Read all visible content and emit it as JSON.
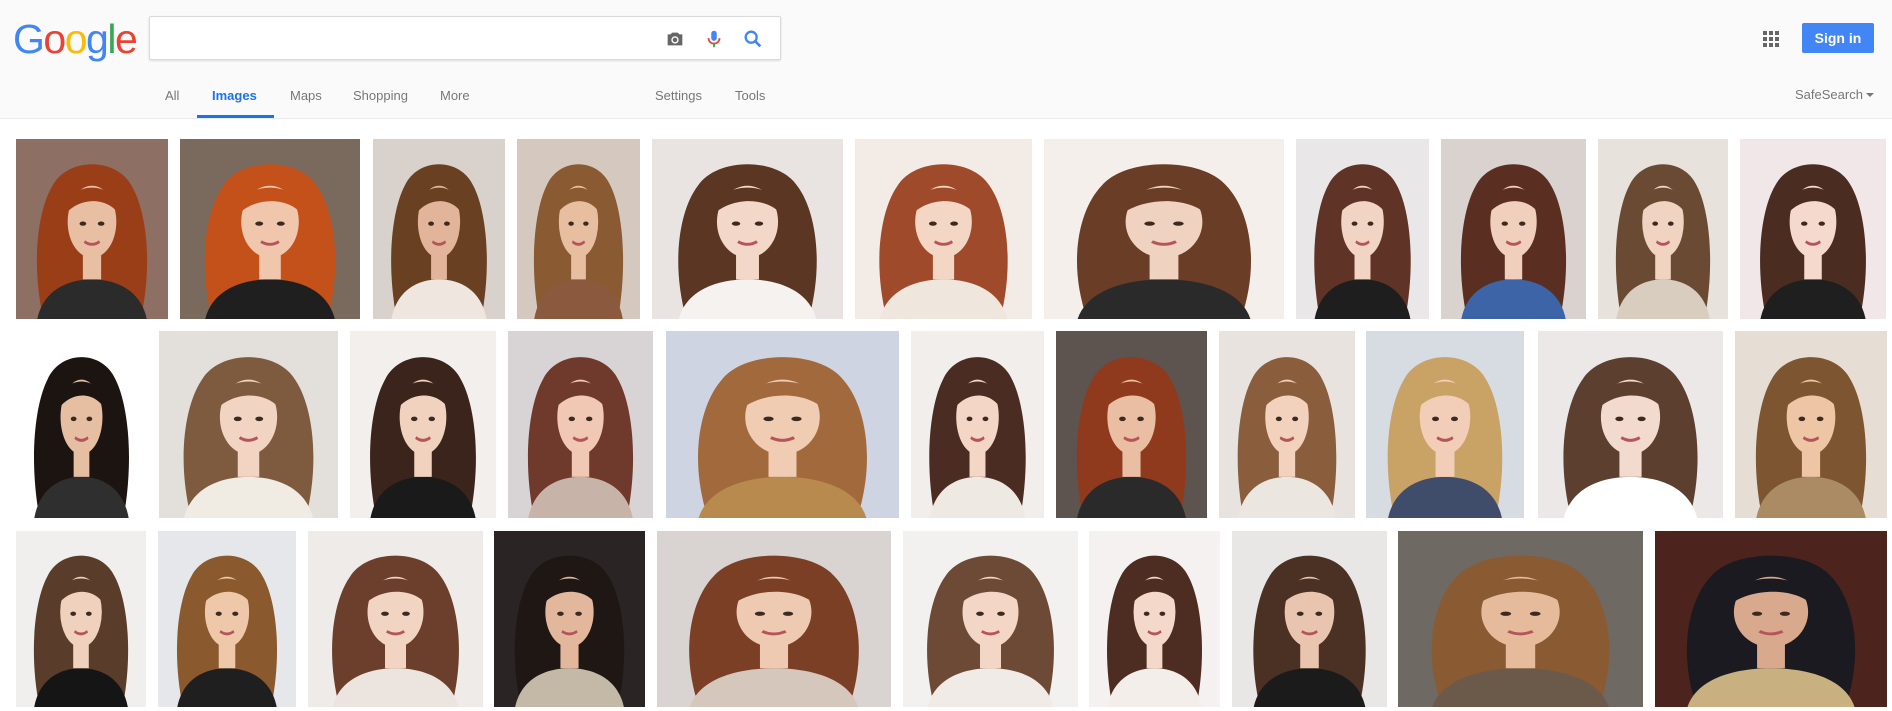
{
  "header": {
    "logo_letters": [
      {
        "ch": "G",
        "color": "#4285f4"
      },
      {
        "ch": "o",
        "color": "#ea4335"
      },
      {
        "ch": "o",
        "color": "#fbbc05"
      },
      {
        "ch": "g",
        "color": "#4285f4"
      },
      {
        "ch": "l",
        "color": "#34a853"
      },
      {
        "ch": "e",
        "color": "#ea4335"
      }
    ],
    "search_value": "",
    "icons": [
      "camera-icon",
      "microphone-icon",
      "search-icon",
      "apps-grid-icon"
    ],
    "sign_in_label": "Sign in",
    "accent_color": "#4285f4"
  },
  "tabs": {
    "all": "All",
    "images": "Images",
    "maps": "Maps",
    "shopping": "Shopping",
    "more": "More",
    "settings": "Settings",
    "tools": "Tools",
    "safesearch": "SafeSearch"
  },
  "results": {
    "rows": [
      [
        {
          "bg": "#8e6f63",
          "hair": "#9a3e18",
          "skin": "#e9bfa3",
          "cloth": "#2b2b2b"
        },
        {
          "bg": "#7a6a5e",
          "hair": "#c4501a",
          "skin": "#f0c6ad",
          "cloth": "#1f1f1f"
        },
        {
          "bg": "#d9d2cc",
          "hair": "#6a4023",
          "skin": "#e2b49a",
          "cloth": "#efe7df"
        },
        {
          "bg": "#d5c9bf",
          "hair": "#8a5a33",
          "skin": "#e7bea0",
          "cloth": "#8b5a3e"
        },
        {
          "bg": "#e9e4e1",
          "hair": "#5a3623",
          "skin": "#f3d8c9",
          "cloth": "#f5f2ef"
        },
        {
          "bg": "#f2ebe6",
          "hair": "#a04a2c",
          "skin": "#f4d6c4",
          "cloth": "#efe6de"
        },
        {
          "bg": "#f4efea",
          "hair": "#6a3d26",
          "skin": "#efd2bf",
          "cloth": "#2a2a2a"
        },
        {
          "bg": "#e9e7e8",
          "hair": "#5f3325",
          "skin": "#f2d4c4",
          "cloth": "#1e1e1e"
        },
        {
          "bg": "#d9d2cf",
          "hair": "#5a2f22",
          "skin": "#f0cfbd",
          "cloth": "#3c64a6"
        },
        {
          "bg": "#e8e2dc",
          "hair": "#6a4a33",
          "skin": "#f1d3c2",
          "cloth": "#d9cdbf"
        },
        {
          "bg": "#f1e7e8",
          "hair": "#4a2c20",
          "skin": "#f4d9cc",
          "cloth": "#1f1f1f"
        }
      ],
      [
        {
          "bg": "#ffffff",
          "hair": "#1c1410",
          "skin": "#e6bfa3",
          "cloth": "#2f2f2f"
        },
        {
          "bg": "#e3dfdb",
          "hair": "#7e5a3e",
          "skin": "#f1d4c2",
          "cloth": "#f0ece4"
        },
        {
          "bg": "#f2efed",
          "hair": "#3b241b",
          "skin": "#f0d2bf",
          "cloth": "#1a1a1a"
        },
        {
          "bg": "#d8d3d4",
          "hair": "#6f3a2b",
          "skin": "#f0c8b3",
          "cloth": "#c8b3a8"
        },
        {
          "bg": "#cfd4e3",
          "hair": "#a26a3c",
          "skin": "#f0cdb2",
          "cloth": "#b88a4e"
        },
        {
          "bg": "#f2eeec",
          "hair": "#4a2c22",
          "skin": "#f3d6c6",
          "cloth": "#efe9e4"
        },
        {
          "bg": "#5d5450",
          "hair": "#8f3a1c",
          "skin": "#e9bea2",
          "cloth": "#2a2a2a"
        },
        {
          "bg": "#e9e3df",
          "hair": "#8a5e3d",
          "skin": "#f2d2bd",
          "cloth": "#ece6e0"
        },
        {
          "bg": "#d7dbe2",
          "hair": "#c9a266",
          "skin": "#f2cdb7",
          "cloth": "#3f4d6a"
        },
        {
          "bg": "#ece8e7",
          "hair": "#5d3f30",
          "skin": "#f3dace",
          "cloth": "#ffffff"
        },
        {
          "bg": "#e6ded4",
          "hair": "#7d5530",
          "skin": "#eec6a6",
          "cloth": "#ab8b64"
        }
      ],
      [
        {
          "bg": "#f1efee",
          "hair": "#5a3c2a",
          "skin": "#efd1bd",
          "cloth": "#151515"
        },
        {
          "bg": "#e5e7ea",
          "hair": "#8a5a2e",
          "skin": "#efc7a9",
          "cloth": "#1f1f1f"
        },
        {
          "bg": "#efebe8",
          "hair": "#6b3f2c",
          "skin": "#f2d4c3",
          "cloth": "#ece5df"
        },
        {
          "bg": "#2a2424",
          "hair": "#1e1714",
          "skin": "#e3b79c",
          "cloth": "#c4b8a6"
        },
        {
          "bg": "#d9d4d1",
          "hair": "#7b3f26",
          "skin": "#efcab2",
          "cloth": "#d6c7bc"
        },
        {
          "bg": "#f3f1ef",
          "hair": "#6d4a36",
          "skin": "#f3d6c6",
          "cloth": "#f0ebe6"
        },
        {
          "bg": "#f4f1f0",
          "hair": "#4d2d22",
          "skin": "#f4d8ca",
          "cloth": "#f3eeea"
        },
        {
          "bg": "#e9e7e6",
          "hair": "#4a3124",
          "skin": "#e9c4ae",
          "cloth": "#1b1b1b"
        },
        {
          "bg": "#6f6963",
          "hair": "#8a5a32",
          "skin": "#e5bb9c",
          "cloth": "#6b5a4a"
        },
        {
          "bg": "#4c231d",
          "hair": "#1a1a20",
          "skin": "#d8a98c",
          "cloth": "#c8b080"
        }
      ]
    ]
  }
}
